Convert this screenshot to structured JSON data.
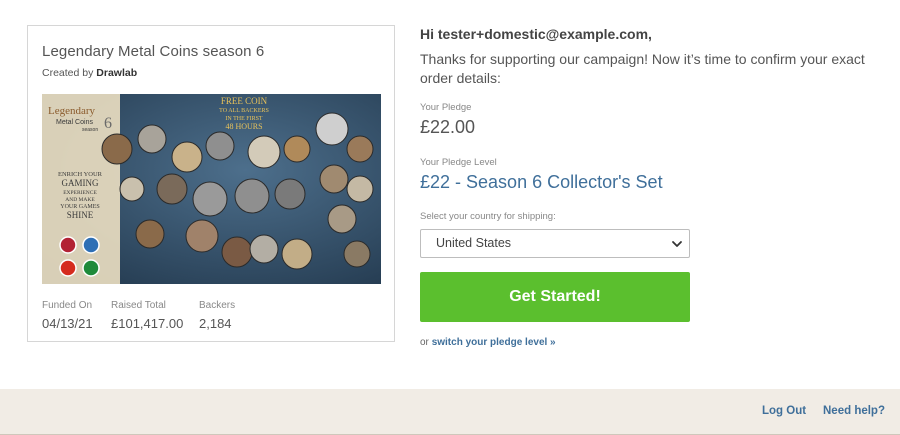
{
  "campaign": {
    "title": "Legendary Metal Coins season 6",
    "created_by_prefix": "Created by",
    "creator": "Drawlab",
    "image_alt": "Legendary Metal Coins season 6 promotional image",
    "image_text": {
      "logo_line1": "Legendary",
      "logo_line2": "Metal Coins",
      "logo_line3": "season",
      "logo_number": "6",
      "promo_line1": "FREE COIN",
      "promo_line2": "TO ALL BACKERS",
      "promo_line3": "IN THE FIRST",
      "promo_line4": "48 HOURS",
      "side_line1": "ENRICH YOUR",
      "side_line2": "GAMING",
      "side_line3": "EXPERIENCE",
      "side_line4": "AND MAKE",
      "side_line5": "YOUR GAMES",
      "side_line6": "SHINE"
    }
  },
  "stats": {
    "funded_on_label": "Funded On",
    "funded_on_value": "04/13/21",
    "raised_label": "Raised Total",
    "raised_value": "£101,417.00",
    "backers_label": "Backers",
    "backers_value": "2,184"
  },
  "order": {
    "greeting": "Hi tester+domestic@example.com,",
    "thanks": "Thanks for supporting our campaign! Now it’s time to confirm your exact order details:",
    "pledge_label": "Your Pledge",
    "pledge_value": "£22.00",
    "level_label": "Your Pledge Level",
    "level_value": "£22 - Season 6 Collector's Set",
    "country_label": "Select your country for shipping:",
    "country_value": "United States",
    "cta_label": "Get Started!",
    "switch_prefix": "or",
    "switch_link": "switch your pledge level »"
  },
  "footer": {
    "logout": "Log Out",
    "help": "Need help?"
  },
  "colors": {
    "accent_green": "#5bbf2e",
    "link_blue": "#3f6f9a",
    "footer_bg": "#f1ece5"
  },
  "icons": {
    "select_chevron": "chevron-down-icon"
  }
}
